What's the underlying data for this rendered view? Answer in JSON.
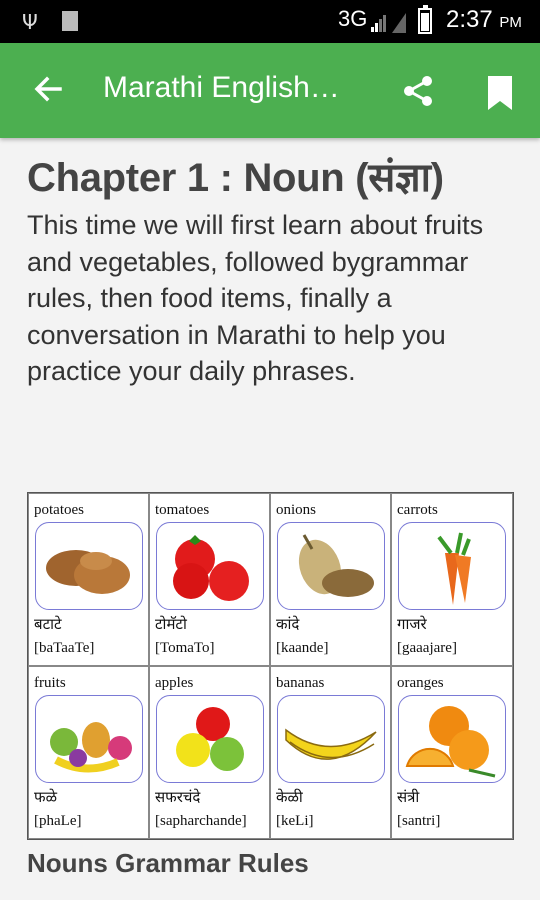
{
  "status_bar": {
    "network": "3G",
    "time": "2:37",
    "ampm": "PM"
  },
  "app_bar": {
    "title": "Marathi English…"
  },
  "content": {
    "chapter_title": "Chapter 1 : Noun (संज्ञा)",
    "intro": "This time we will first learn about fruits and vegetables, followed bygrammar rules, then food items, finally a conversation in Marathi to help you practice your daily phrases.",
    "items": [
      {
        "english": "potatoes",
        "marathi": "बटाटे",
        "translit": "[baTaaTe]",
        "icon": "potatoes-icon"
      },
      {
        "english": "tomatoes",
        "marathi": "टोमॅटो",
        "translit": "[TomaTo]",
        "icon": "tomatoes-icon"
      },
      {
        "english": "onions",
        "marathi": "कांदे",
        "translit": "[kaande]",
        "icon": "onions-icon"
      },
      {
        "english": "carrots",
        "marathi": "गाजरे",
        "translit": "[gaaajare]",
        "icon": "carrots-icon"
      },
      {
        "english": "fruits",
        "marathi": "फळे",
        "translit": "[phaLe]",
        "icon": "fruits-icon"
      },
      {
        "english": "apples",
        "marathi": "सफरचंदे",
        "translit": "[sapharchande]",
        "icon": "apples-icon"
      },
      {
        "english": "bananas",
        "marathi": "केळी",
        "translit": "[keLi]",
        "icon": "bananas-icon"
      },
      {
        "english": "oranges",
        "marathi": "संत्री",
        "translit": "[santri]",
        "icon": "oranges-icon"
      }
    ],
    "section_heading": "Nouns Grammar Rules"
  }
}
